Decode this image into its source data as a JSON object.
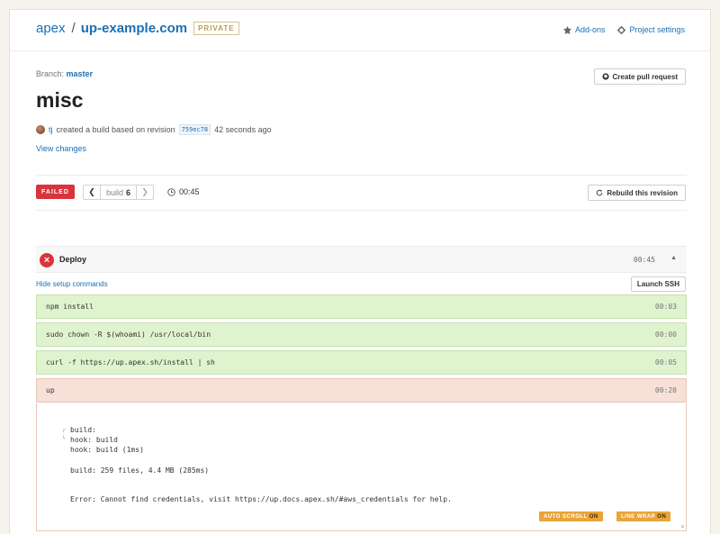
{
  "header": {
    "org": "apex",
    "separator": "/",
    "repo": "up-example.com",
    "visibility": "PRIVATE",
    "addons_label": "Add-ons",
    "settings_label": "Project settings"
  },
  "build": {
    "branch_label": "Branch:",
    "branch": "master",
    "title": "misc",
    "create_pr_label": "Create pull request",
    "user": "tj",
    "action_text": "created a build based on revision",
    "revision": "759ec78",
    "time_ago": "42 seconds ago",
    "view_changes": "View changes",
    "status": "FAILED",
    "build_label": "build",
    "build_number": "6",
    "duration": "00:45",
    "rebuild_label": "Rebuild this revision"
  },
  "deploy": {
    "title": "Deploy",
    "time": "00:45",
    "hide_setup": "Hide setup commands",
    "launch_ssh": "Launch SSH",
    "steps": [
      {
        "command": "npm install",
        "time": "00:03",
        "status": "success"
      },
      {
        "command": "sudo chown -R $(whoami) /usr/local/bin",
        "time": "00:00",
        "status": "success"
      },
      {
        "command": "curl -f https://up.apex.sh/install | sh",
        "time": "00:05",
        "status": "success"
      },
      {
        "command": "up",
        "time": "00:20",
        "status": "failed"
      }
    ],
    "output": [
      "build:",
      "hook: build",
      "hook: build (1ms)",
      "build: 259 files, 4.4 MB (285ms)",
      "Error: Cannot find credentials, visit https://up.docs.apex.sh/#aws_credentials for help."
    ],
    "auto_scroll_label": "AUTO SCROLL",
    "auto_scroll_state": "ON",
    "line_wrap_label": "LINE WRAP",
    "line_wrap_state": "ON"
  },
  "colors": {
    "link": "#1b6fb5",
    "failed": "#d9343b",
    "success_bg": "#dff3cf",
    "failed_bg": "#f6e0d8",
    "toggle": "#e8a53a"
  }
}
